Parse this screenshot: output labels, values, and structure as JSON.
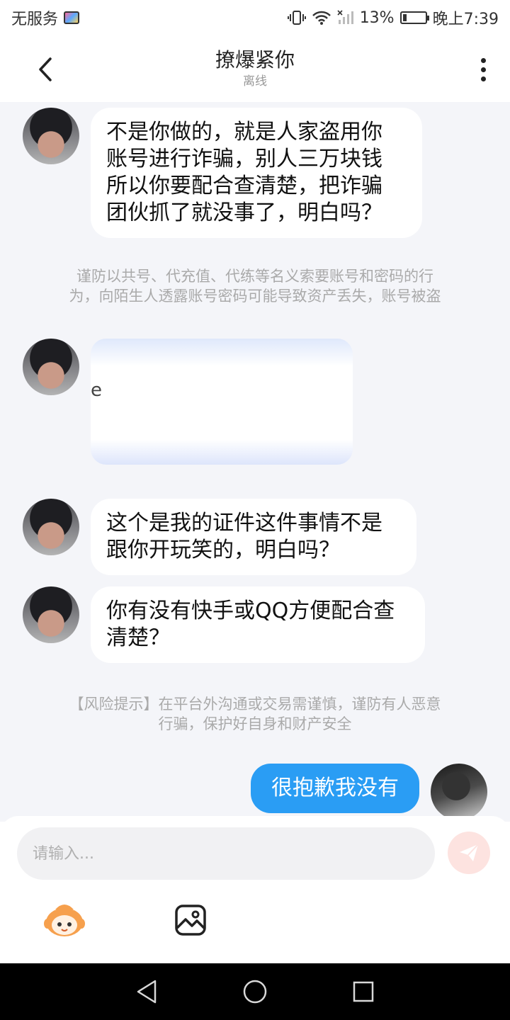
{
  "status_bar": {
    "carrier": "无服务",
    "battery": "13%",
    "time": "晚上7:39"
  },
  "header": {
    "title": "撩爆紧你",
    "subtitle": "离线"
  },
  "messages": {
    "m1": "不是你做的，就是人家盗用你\n账号进行诈骗，别人三万块钱\n所以你要配合查清楚，把诈骗\n团伙抓了就没事了，明白吗？",
    "m3": "这个是我的证件这件事情不是\n跟你开玩笑的，明白吗？",
    "m4": "你有没有快手或QQ方便配合查\n清楚？",
    "m5": "很抱歉我没有"
  },
  "notices": {
    "n1": "谨防以共号、代充值、代练等名义索要账号和密码的行\n为，向陌生人透露账号密码可能导致资产丢失，账号被盗",
    "n2": "【风险提示】在平台外沟通或交易需谨慎，谨防有人恶意\n行骗，保护好自身和财产安全"
  },
  "image_message": {
    "glyph": "e"
  },
  "input": {
    "placeholder": "请输入..."
  },
  "colors": {
    "my_bubble": "#2a9df4",
    "chat_background": "#f4f5f9",
    "send_button": "#fde3e0"
  },
  "icons": [
    "back-icon",
    "more-icon",
    "send-icon",
    "emoji-icon",
    "image-icon",
    "nav-back-icon",
    "nav-home-icon",
    "nav-recents-icon"
  ]
}
